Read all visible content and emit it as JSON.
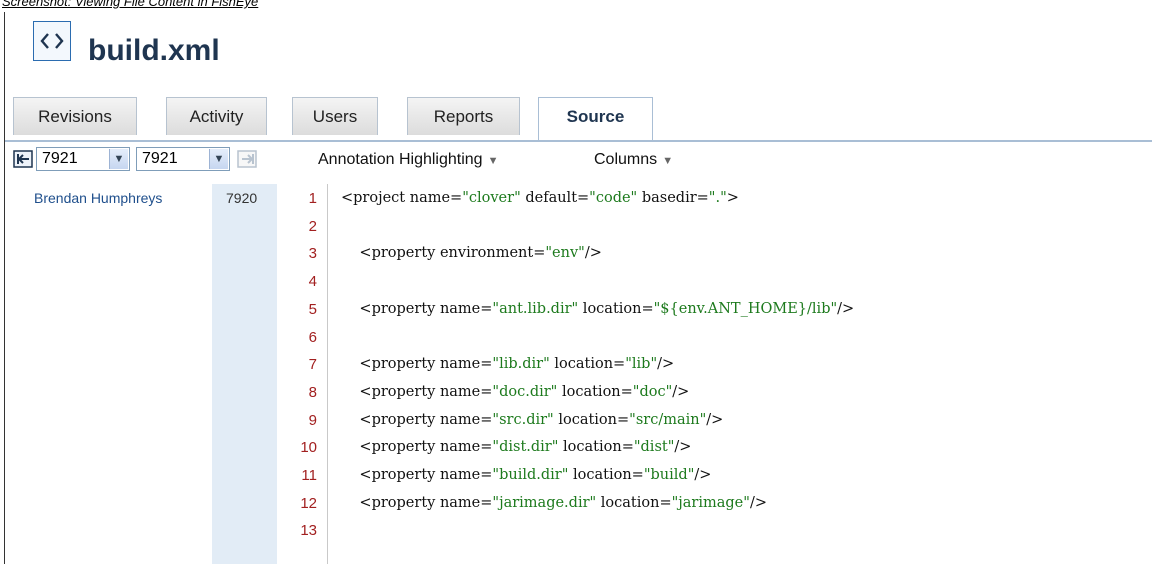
{
  "caption": "Screenshot: Viewing File Content in FishEye",
  "header": {
    "title": "build.xml",
    "icon": "xml-file-icon"
  },
  "tabs": [
    {
      "label": "Revisions",
      "active": false
    },
    {
      "label": "Activity",
      "active": false
    },
    {
      "label": "Users",
      "active": false
    },
    {
      "label": "Reports",
      "active": false
    },
    {
      "label": "Source",
      "active": true
    }
  ],
  "toolbar": {
    "from_revision": "7921",
    "to_revision": "7921",
    "annotation_menu": "Annotation Highlighting",
    "columns_menu": "Columns"
  },
  "annotation": {
    "author": "Brendan Humphreys",
    "revision": "7920"
  },
  "code": {
    "lines": [
      {
        "n": "1",
        "parts": [
          [
            "<project name=",
            ""
          ],
          [
            "\"clover\"",
            "str"
          ],
          [
            " default=",
            ""
          ],
          [
            "\"code\"",
            "str"
          ],
          [
            " basedir=",
            ""
          ],
          [
            "\".\"",
            "str"
          ],
          [
            ">",
            ""
          ]
        ]
      },
      {
        "n": "2",
        "parts": []
      },
      {
        "n": "3",
        "parts": [
          [
            "    <property environment=",
            ""
          ],
          [
            "\"env\"",
            "str"
          ],
          [
            "/>",
            ""
          ]
        ]
      },
      {
        "n": "4",
        "parts": []
      },
      {
        "n": "5",
        "parts": [
          [
            "    <property name=",
            ""
          ],
          [
            "\"ant.lib.dir\"",
            "str"
          ],
          [
            " location=",
            ""
          ],
          [
            "\"${env.ANT_HOME}/lib\"",
            "str"
          ],
          [
            "/>",
            ""
          ]
        ]
      },
      {
        "n": "6",
        "parts": []
      },
      {
        "n": "7",
        "parts": [
          [
            "    <property name=",
            ""
          ],
          [
            "\"lib.dir\"",
            "str"
          ],
          [
            " location=",
            ""
          ],
          [
            "\"lib\"",
            "str"
          ],
          [
            "/>",
            ""
          ]
        ]
      },
      {
        "n": "8",
        "parts": [
          [
            "    <property name=",
            ""
          ],
          [
            "\"doc.dir\"",
            "str"
          ],
          [
            " location=",
            ""
          ],
          [
            "\"doc\"",
            "str"
          ],
          [
            "/>",
            ""
          ]
        ]
      },
      {
        "n": "9",
        "parts": [
          [
            "    <property name=",
            ""
          ],
          [
            "\"src.dir\"",
            "str"
          ],
          [
            " location=",
            ""
          ],
          [
            "\"src/main\"",
            "str"
          ],
          [
            "/>",
            ""
          ]
        ]
      },
      {
        "n": "10",
        "parts": [
          [
            "    <property name=",
            ""
          ],
          [
            "\"dist.dir\"",
            "str"
          ],
          [
            " location=",
            ""
          ],
          [
            "\"dist\"",
            "str"
          ],
          [
            "/>",
            ""
          ]
        ]
      },
      {
        "n": "11",
        "parts": [
          [
            "    <property name=",
            ""
          ],
          [
            "\"build.dir\"",
            "str"
          ],
          [
            " location=",
            ""
          ],
          [
            "\"build\"",
            "str"
          ],
          [
            "/>",
            ""
          ]
        ]
      },
      {
        "n": "12",
        "parts": [
          [
            "    <property name=",
            ""
          ],
          [
            "\"jarimage.dir\"",
            "str"
          ],
          [
            " location=",
            ""
          ],
          [
            "\"jarimage\"",
            "str"
          ],
          [
            "/>",
            ""
          ]
        ]
      },
      {
        "n": "13",
        "parts": []
      }
    ]
  },
  "colors": {
    "title": "#1f3550",
    "string": "#1d7a1d",
    "line_number": "#a22020",
    "revision_column": "#e2ecf6"
  }
}
